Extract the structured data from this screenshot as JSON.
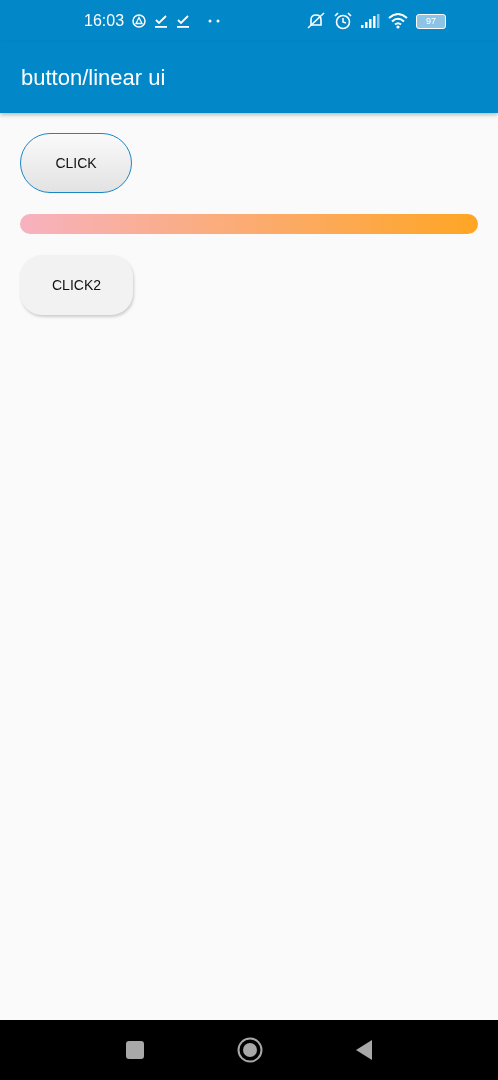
{
  "status_bar": {
    "time": "16:03",
    "battery": "97"
  },
  "app_bar": {
    "title": "button/linear ui"
  },
  "buttons": [
    {
      "label": "CLICK",
      "kind": "outlined"
    },
    {
      "label": "CLICK2",
      "kind": "raised"
    }
  ]
}
